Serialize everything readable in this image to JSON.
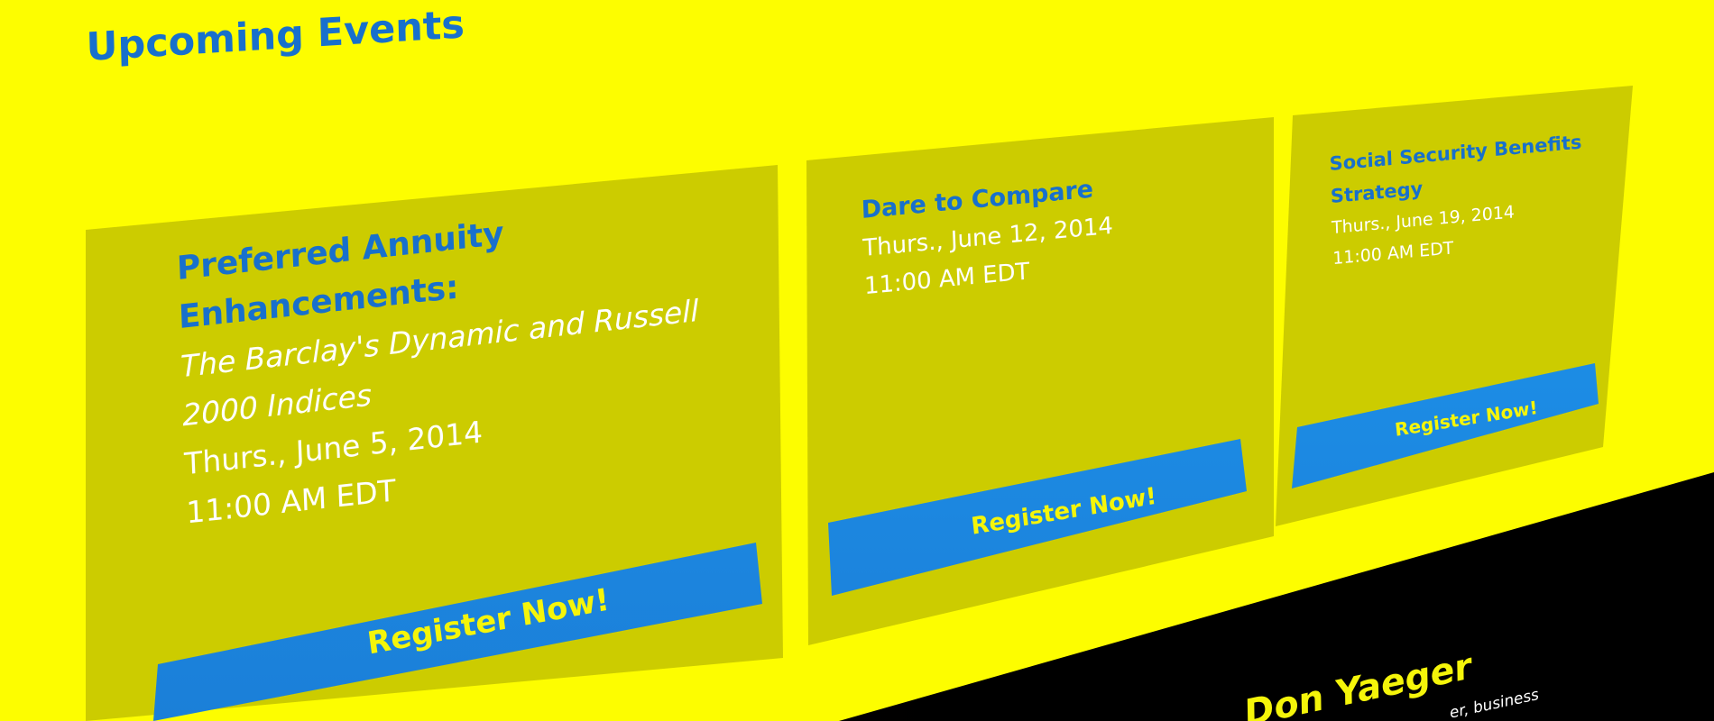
{
  "section": {
    "heading": "Upcoming Events"
  },
  "events": [
    {
      "title_line1": "Preferred Annuity",
      "title_line2": "Enhancements:",
      "subtitle_line1": "The Barclay's Dynamic and Russell",
      "subtitle_line2": "2000 Indices",
      "date": "Thurs., June 5, 2014",
      "time": "11:00 AM EDT",
      "button_label": "Register Now!"
    },
    {
      "title_line1": "Dare to Compare",
      "date": "Thurs., June 12, 2014",
      "time": "11:00 AM EDT",
      "button_label": "Register Now!"
    },
    {
      "title_line1": "Social Security Benefits",
      "title_line2": "Strategy",
      "date": "Thurs., June 19, 2014",
      "time": "11:00 AM EDT",
      "button_label": "Register Now!"
    }
  ],
  "speaker": {
    "name": "Don Yaeger",
    "snippet": "er, business"
  },
  "colors": {
    "background": "#fdfd00",
    "card": "#cccc00",
    "title_blue": "#1870cc",
    "button_blue": "#1e8fe8",
    "button_text": "#f5f50a"
  }
}
